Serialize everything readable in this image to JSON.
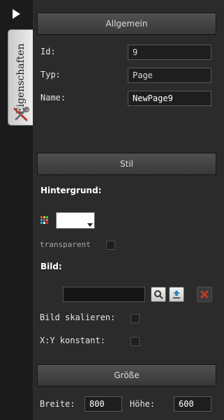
{
  "sidebar": {
    "tab_label": "Eigenschaften"
  },
  "general": {
    "header": "Allgemein",
    "id_label": "Id:",
    "id_value": "9",
    "type_label": "Typ:",
    "type_value": "Page",
    "name_label": "Name:",
    "name_value": "NewPage9"
  },
  "style": {
    "header": "Stil",
    "background_label": "Hintergrund:",
    "background_color": "#ffffff",
    "transparent_label": "transparent",
    "image_label": "Bild:",
    "image_value": "",
    "scale_image_label": "Bild skalieren:",
    "keep_ratio_label": "X:Y konstant:"
  },
  "size": {
    "header": "Größe",
    "width_label": "Breite:",
    "width_value": "800",
    "height_label": "Höhe:",
    "height_value": "600"
  }
}
